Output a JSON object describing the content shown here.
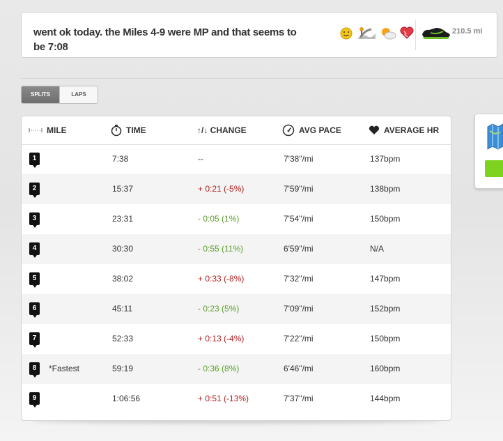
{
  "note": {
    "text": "went ok today. the Miles 4-9 were MP and that seems to be 7:08"
  },
  "run_tags": {
    "icons": [
      "happy-face-icon",
      "trail-terrain-icon",
      "sun-cloud-weather-icon",
      "heart-emotion-icon"
    ],
    "shoe_icon": "running-shoe-icon",
    "shoe_distance": "210.5 mi"
  },
  "tabs": [
    {
      "label": "SPLITS",
      "active": true
    },
    {
      "label": "LAPS",
      "active": false
    }
  ],
  "table": {
    "headers": {
      "mile": "MILE",
      "time": "TIME",
      "change": "↑/↓ CHANGE",
      "pace": "AVG PACE",
      "hr": "AVERAGE HR"
    },
    "header_icons": {
      "mile": "dotted-ruler-icon",
      "time": "stopwatch-icon",
      "pace": "speedometer-icon",
      "hr": "heart-icon"
    },
    "rows": [
      {
        "mile": "1",
        "note": "",
        "time": "7:38",
        "change": "--",
        "change_dir": "none",
        "pace": "7'38\"/mi",
        "hr": "137bpm"
      },
      {
        "mile": "2",
        "note": "",
        "time": "15:37",
        "change": "+ 0:21 (-5%)",
        "change_dir": "slower",
        "pace": "7'59\"/mi",
        "hr": "138bpm"
      },
      {
        "mile": "3",
        "note": "",
        "time": "23:31",
        "change": "- 0:05 (1%)",
        "change_dir": "faster",
        "pace": "7'54\"/mi",
        "hr": "150bpm"
      },
      {
        "mile": "4",
        "note": "",
        "time": "30:30",
        "change": "- 0:55 (11%)",
        "change_dir": "faster",
        "pace": "6'59\"/mi",
        "hr": "N/A"
      },
      {
        "mile": "5",
        "note": "",
        "time": "38:02",
        "change": "+ 0:33 (-8%)",
        "change_dir": "slower",
        "pace": "7'32\"/mi",
        "hr": "147bpm"
      },
      {
        "mile": "6",
        "note": "",
        "time": "45:11",
        "change": "- 0:23 (5%)",
        "change_dir": "faster",
        "pace": "7'09\"/mi",
        "hr": "152bpm"
      },
      {
        "mile": "7",
        "note": "",
        "time": "52:33",
        "change": "+ 0:13 (-4%)",
        "change_dir": "slower",
        "pace": "7'22\"/mi",
        "hr": "150bpm"
      },
      {
        "mile": "8",
        "note": "*Fastest",
        "time": "59:19",
        "change": "- 0:36 (8%)",
        "change_dir": "faster",
        "pace": "6'46\"/mi",
        "hr": "160bpm"
      },
      {
        "mile": "9",
        "note": "",
        "time": "1:06:56",
        "change": "+ 0:51 (-13%)",
        "change_dir": "slower",
        "pace": "7'37\"/mi",
        "hr": "144bpm"
      }
    ]
  },
  "colors": {
    "slower": "#b22222",
    "faster": "#5a9e2b",
    "side_button": "#7ed321"
  }
}
